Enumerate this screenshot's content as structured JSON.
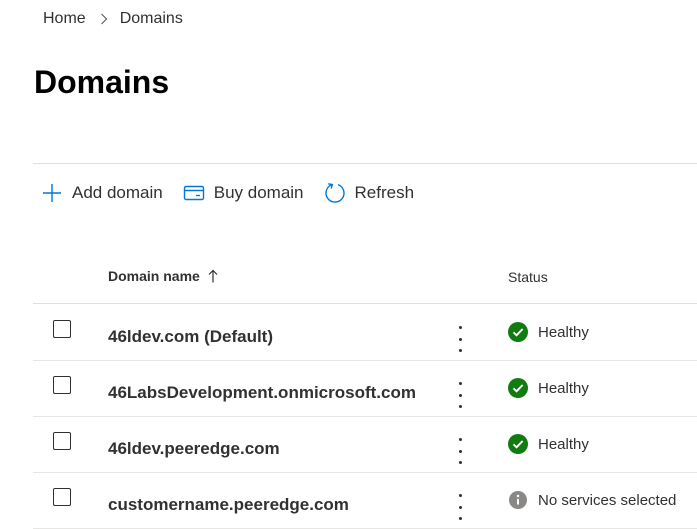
{
  "breadcrumb": {
    "items": [
      "Home",
      "Domains"
    ]
  },
  "page": {
    "title": "Domains"
  },
  "toolbar": {
    "add_label": "Add domain",
    "buy_label": "Buy domain",
    "refresh_label": "Refresh"
  },
  "table": {
    "headers": {
      "name": "Domain name",
      "status": "Status"
    },
    "sort": "ascending",
    "rows": [
      {
        "name": "46ldev.com (Default)",
        "status": "Healthy",
        "status_icon": "check-circle-icon"
      },
      {
        "name": "46LabsDevelopment.onmicrosoft.com",
        "status": "Healthy",
        "status_icon": "check-circle-icon"
      },
      {
        "name": "46ldev.peeredge.com",
        "status": "Healthy",
        "status_icon": "check-circle-icon"
      },
      {
        "name": "customername.peeredge.com",
        "status": "No services selected",
        "status_icon": "info-circle-icon"
      }
    ]
  },
  "colors": {
    "accent": "#0078d4",
    "healthy": "#107c10",
    "neutral": "#8a8886"
  }
}
